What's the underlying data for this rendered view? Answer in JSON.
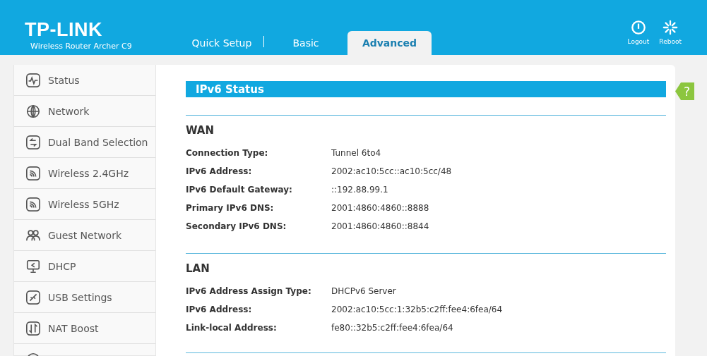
{
  "header": {
    "brand": "TP-LINK",
    "model": "Wireless Router Archer C9",
    "tabs": [
      {
        "label": "Quick Setup",
        "selected": false
      },
      {
        "label": "Basic",
        "selected": false
      },
      {
        "label": "Advanced",
        "selected": true
      }
    ],
    "actions": [
      {
        "label": "Logout",
        "kind": "logout"
      },
      {
        "label": "Reboot",
        "kind": "reboot"
      }
    ]
  },
  "sidebar": {
    "items": [
      {
        "label": "Status",
        "kind": "status",
        "selected": false
      },
      {
        "label": "Network",
        "kind": "globe",
        "selected": false
      },
      {
        "label": "Dual Band Selection",
        "kind": "swap",
        "selected": false
      },
      {
        "label": "Wireless 2.4GHz",
        "kind": "wifi",
        "selected": false
      },
      {
        "label": "Wireless 5GHz",
        "kind": "wifi",
        "selected": false
      },
      {
        "label": "Guest Network",
        "kind": "guests",
        "selected": false
      },
      {
        "label": "DHCP",
        "kind": "monitor",
        "selected": false
      },
      {
        "label": "USB Settings",
        "kind": "usb",
        "selected": false
      },
      {
        "label": "NAT Boost",
        "kind": "updown",
        "selected": false
      },
      {
        "kind": "partial",
        "selected": false
      }
    ]
  },
  "content": {
    "title": "IPv6 Status",
    "help": "?",
    "sections": [
      {
        "heading": "WAN",
        "rows": [
          {
            "label": "Connection Type:",
            "value": "Tunnel 6to4"
          },
          {
            "label": "IPv6 Address:",
            "value": "2002:ac10:5cc::ac10:5cc/48"
          },
          {
            "label": "IPv6 Default Gateway:",
            "value": "::192.88.99.1"
          },
          {
            "label": "Primary IPv6 DNS:",
            "value": "2001:4860:4860::8888"
          },
          {
            "label": "Secondary IPv6 DNS:",
            "value": "2001:4860:4860::8844"
          }
        ]
      },
      {
        "heading": "LAN",
        "rows": [
          {
            "label": "IPv6 Address Assign Type:",
            "value": "DHCPv6 Server"
          },
          {
            "label": "IPv6 Address:",
            "value": "2002:ac10:5cc:1:32b5:c2ff:fee4:6fea/64"
          },
          {
            "label": "Link-local Address:",
            "value": "fe80::32b5:c2ff:fee4:6fea/64"
          }
        ]
      }
    ]
  }
}
